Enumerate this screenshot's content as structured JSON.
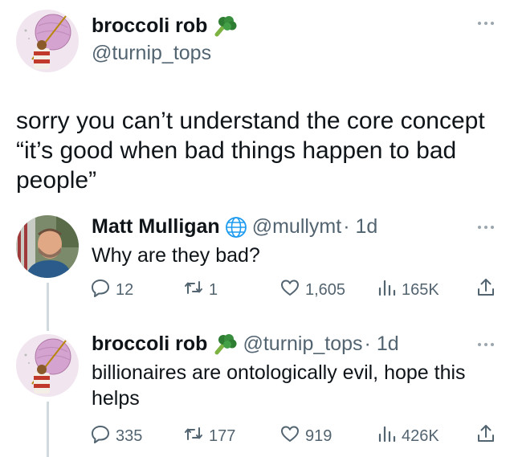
{
  "main": {
    "name": "broccoli rob",
    "handle": "@turnip_tops",
    "text": "sorry you can’t understand the core concept “it’s good when bad things happen to bad people”",
    "icons": {
      "emoji": "broccoli-icon",
      "more": "more-icon"
    }
  },
  "reply1": {
    "name": "Matt Mulligan",
    "handle": "@mullymt",
    "time": "· 1d",
    "text": "Why are they bad?",
    "stats": {
      "replies": "12",
      "retweets": "1",
      "likes": "1,605",
      "views": "165K"
    },
    "icons": {
      "badge": "globe-icon"
    }
  },
  "reply2": {
    "name": "broccoli rob",
    "handle": "@turnip_tops",
    "time": "· 1d",
    "text": "billionaires are ontologically evil, hope this helps",
    "stats": {
      "replies": "335",
      "retweets": "177",
      "likes": "919",
      "views": "426K"
    },
    "icons": {
      "emoji": "broccoli-icon"
    }
  },
  "colors": {
    "text": "#0f1419",
    "muted": "#536471",
    "thread": "#cfd9de",
    "accent": "#1d9bf0"
  }
}
